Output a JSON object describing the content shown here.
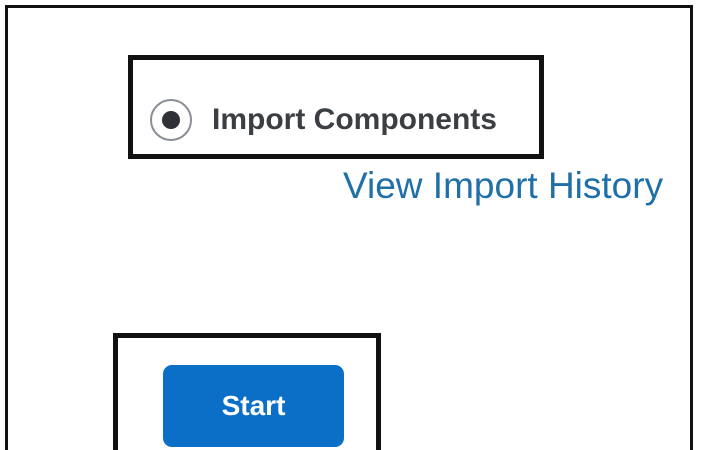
{
  "import": {
    "option_label": "Import Components",
    "option_selected": true,
    "history_link": "View Import History",
    "start_label": "Start"
  },
  "colors": {
    "link": "#1f6fa8",
    "button": "#0b6fc8",
    "radio_fill": "#2f3136",
    "highlight": "#111111"
  },
  "icons": {
    "radio": "radio-selected-icon"
  }
}
